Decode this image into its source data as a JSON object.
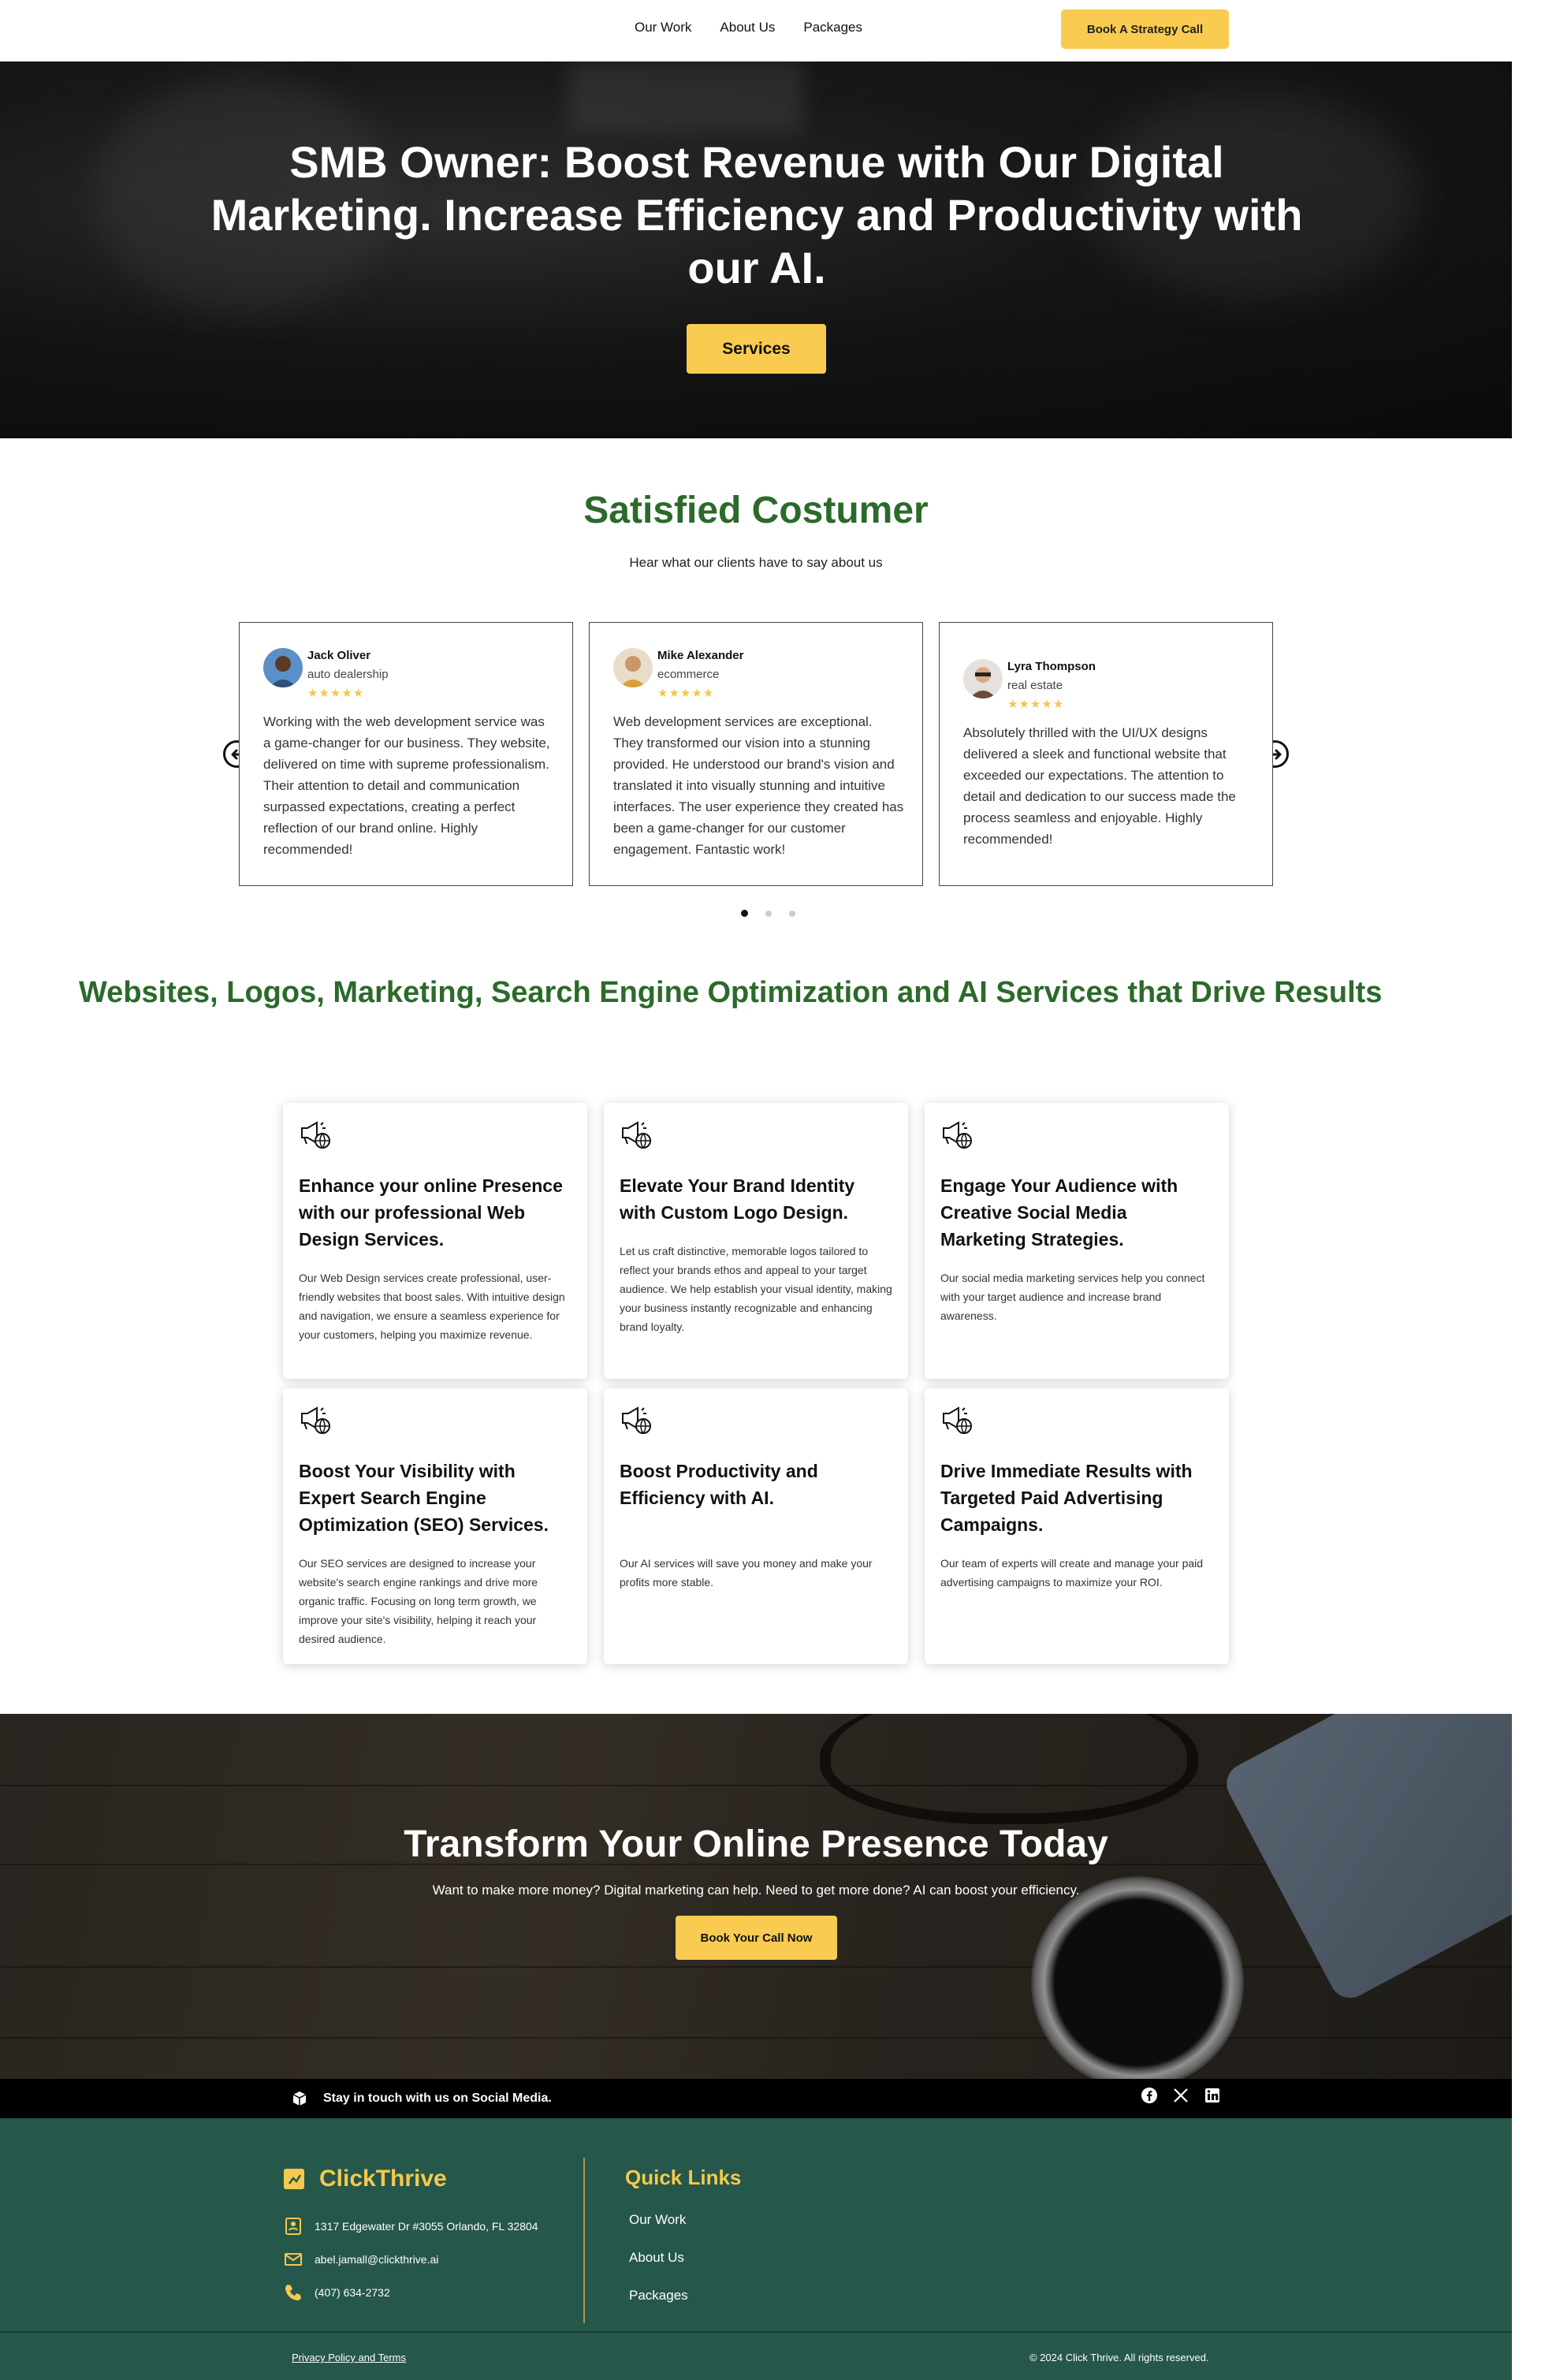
{
  "header": {
    "nav": [
      "Our Work",
      "About Us",
      "Packages"
    ],
    "cta": "Book A Strategy Call"
  },
  "hero": {
    "title": "SMB Owner: Boost Revenue with Our Digital Marketing. Increase Efficiency and Productivity with our AI.",
    "button": "Services"
  },
  "testimonials": {
    "title": "Satisfied Costumer",
    "subtitle": "Hear what our clients have to say about us",
    "rating_stars": "★★★★★",
    "items": [
      {
        "name": "Jack Oliver",
        "role": "auto dealership",
        "text": "Working with the web development service was a game-changer for our business. They website, delivered on time with supreme professionalism. Their attention to detail and communication surpassed expectations, creating a perfect reflection of our brand online. Highly recommended!"
      },
      {
        "name": "Mike Alexander",
        "role": "ecommerce",
        "text": "Web development services are exceptional. They transformed our vision into a stunning provided. He understood our brand's vision and translated it into visually stunning and intuitive interfaces. The user experience they created has been a game-changer for our customer engagement. Fantastic work!"
      },
      {
        "name": "Lyra Thompson",
        "role": "real estate",
        "text": "Absolutely thrilled with the UI/UX designs delivered a sleek and functional website that exceeded our expectations. The attention to detail and dedication to our success made the process seamless and enjoyable. Highly recommended!"
      }
    ],
    "prev_icon": "arrow-left-circle-icon",
    "next_icon": "arrow-right-circle-icon",
    "active_slide": 1,
    "slide_count": 3
  },
  "services": {
    "title": "Websites, Logos, Marketing, Search Engine Optimization and AI Services that Drive Results",
    "icon": "megaphone-globe-icon",
    "items": [
      {
        "title": "Enhance your online Presence with our professional Web Design Services.",
        "desc": "Our Web Design services create professional, user-friendly websites that boost sales. With intuitive design and navigation, we ensure a seamless experience for your customers, helping you maximize revenue."
      },
      {
        "title": "Elevate Your Brand Identity with Custom Logo Design.",
        "desc": "Let us craft distinctive, memorable logos tailored to reflect your brands ethos and appeal to your target audience. We help establish your visual identity, making your business instantly recognizable and enhancing brand loyalty."
      },
      {
        "title": "Engage Your Audience with Creative Social Media Marketing Strategies.",
        "desc": "Our social media marketing services help you connect with your target audience and increase brand awareness."
      },
      {
        "title": "Boost Your Visibility with Expert Search Engine Optimization (SEO) Services.",
        "desc": "Our SEO services are designed to increase your website's search engine rankings and drive more organic traffic. Focusing on long term growth, we improve your site's visibility, helping it reach your desired audience."
      },
      {
        "title": "Boost Productivity and Efficiency with AI.",
        "desc": "Our AI services will save you money and make your profits more stable."
      },
      {
        "title": "Drive Immediate Results with Targeted Paid Advertising Campaigns.",
        "desc": "Our team of experts will create and manage your paid advertising campaigns to maximize your ROI."
      }
    ]
  },
  "cta": {
    "title": "Transform Your Online Presence Today",
    "subtitle": "Want to make more money? Digital marketing can help. Need to get more done? AI can boost your efficiency.",
    "button": "Book Your Call Now"
  },
  "social": {
    "label": "Stay in touch with us on Social Media.",
    "icons": [
      "facebook-icon",
      "x-icon",
      "linkedin-icon"
    ]
  },
  "footer": {
    "brand": "ClickThrive",
    "address": "1317 Edgewater Dr #3055 Orlando, FL 32804",
    "email": "abel.jamall@clickthrive.ai",
    "phone": "(407) 634-2732",
    "quick_links_title": "Quick Links",
    "quick_links": [
      "Our Work",
      "About Us",
      "Packages"
    ],
    "privacy": "Privacy Policy and Terms",
    "copyright": "© 2024 Click Thrive. All rights reserved."
  },
  "colors": {
    "accent_yellow": "#f9cb51",
    "heading_green": "#2b6a2b",
    "footer_green": "#26574b",
    "star_gold": "#f3c64b"
  }
}
